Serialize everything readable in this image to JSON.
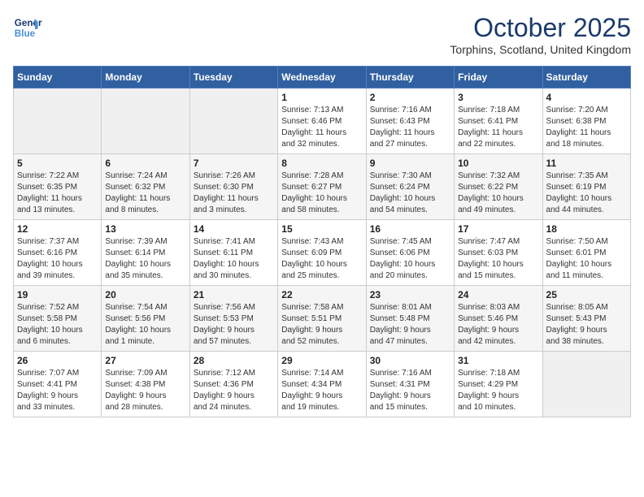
{
  "logo": {
    "line1": "General",
    "line2": "Blue"
  },
  "title": "October 2025",
  "subtitle": "Torphins, Scotland, United Kingdom",
  "headers": [
    "Sunday",
    "Monday",
    "Tuesday",
    "Wednesday",
    "Thursday",
    "Friday",
    "Saturday"
  ],
  "weeks": [
    [
      {
        "num": "",
        "info": ""
      },
      {
        "num": "",
        "info": ""
      },
      {
        "num": "",
        "info": ""
      },
      {
        "num": "1",
        "info": "Sunrise: 7:13 AM\nSunset: 6:46 PM\nDaylight: 11 hours\nand 32 minutes."
      },
      {
        "num": "2",
        "info": "Sunrise: 7:16 AM\nSunset: 6:43 PM\nDaylight: 11 hours\nand 27 minutes."
      },
      {
        "num": "3",
        "info": "Sunrise: 7:18 AM\nSunset: 6:41 PM\nDaylight: 11 hours\nand 22 minutes."
      },
      {
        "num": "4",
        "info": "Sunrise: 7:20 AM\nSunset: 6:38 PM\nDaylight: 11 hours\nand 18 minutes."
      }
    ],
    [
      {
        "num": "5",
        "info": "Sunrise: 7:22 AM\nSunset: 6:35 PM\nDaylight: 11 hours\nand 13 minutes."
      },
      {
        "num": "6",
        "info": "Sunrise: 7:24 AM\nSunset: 6:32 PM\nDaylight: 11 hours\nand 8 minutes."
      },
      {
        "num": "7",
        "info": "Sunrise: 7:26 AM\nSunset: 6:30 PM\nDaylight: 11 hours\nand 3 minutes."
      },
      {
        "num": "8",
        "info": "Sunrise: 7:28 AM\nSunset: 6:27 PM\nDaylight: 10 hours\nand 58 minutes."
      },
      {
        "num": "9",
        "info": "Sunrise: 7:30 AM\nSunset: 6:24 PM\nDaylight: 10 hours\nand 54 minutes."
      },
      {
        "num": "10",
        "info": "Sunrise: 7:32 AM\nSunset: 6:22 PM\nDaylight: 10 hours\nand 49 minutes."
      },
      {
        "num": "11",
        "info": "Sunrise: 7:35 AM\nSunset: 6:19 PM\nDaylight: 10 hours\nand 44 minutes."
      }
    ],
    [
      {
        "num": "12",
        "info": "Sunrise: 7:37 AM\nSunset: 6:16 PM\nDaylight: 10 hours\nand 39 minutes."
      },
      {
        "num": "13",
        "info": "Sunrise: 7:39 AM\nSunset: 6:14 PM\nDaylight: 10 hours\nand 35 minutes."
      },
      {
        "num": "14",
        "info": "Sunrise: 7:41 AM\nSunset: 6:11 PM\nDaylight: 10 hours\nand 30 minutes."
      },
      {
        "num": "15",
        "info": "Sunrise: 7:43 AM\nSunset: 6:09 PM\nDaylight: 10 hours\nand 25 minutes."
      },
      {
        "num": "16",
        "info": "Sunrise: 7:45 AM\nSunset: 6:06 PM\nDaylight: 10 hours\nand 20 minutes."
      },
      {
        "num": "17",
        "info": "Sunrise: 7:47 AM\nSunset: 6:03 PM\nDaylight: 10 hours\nand 15 minutes."
      },
      {
        "num": "18",
        "info": "Sunrise: 7:50 AM\nSunset: 6:01 PM\nDaylight: 10 hours\nand 11 minutes."
      }
    ],
    [
      {
        "num": "19",
        "info": "Sunrise: 7:52 AM\nSunset: 5:58 PM\nDaylight: 10 hours\nand 6 minutes."
      },
      {
        "num": "20",
        "info": "Sunrise: 7:54 AM\nSunset: 5:56 PM\nDaylight: 10 hours\nand 1 minute."
      },
      {
        "num": "21",
        "info": "Sunrise: 7:56 AM\nSunset: 5:53 PM\nDaylight: 9 hours\nand 57 minutes."
      },
      {
        "num": "22",
        "info": "Sunrise: 7:58 AM\nSunset: 5:51 PM\nDaylight: 9 hours\nand 52 minutes."
      },
      {
        "num": "23",
        "info": "Sunrise: 8:01 AM\nSunset: 5:48 PM\nDaylight: 9 hours\nand 47 minutes."
      },
      {
        "num": "24",
        "info": "Sunrise: 8:03 AM\nSunset: 5:46 PM\nDaylight: 9 hours\nand 42 minutes."
      },
      {
        "num": "25",
        "info": "Sunrise: 8:05 AM\nSunset: 5:43 PM\nDaylight: 9 hours\nand 38 minutes."
      }
    ],
    [
      {
        "num": "26",
        "info": "Sunrise: 7:07 AM\nSunset: 4:41 PM\nDaylight: 9 hours\nand 33 minutes."
      },
      {
        "num": "27",
        "info": "Sunrise: 7:09 AM\nSunset: 4:38 PM\nDaylight: 9 hours\nand 28 minutes."
      },
      {
        "num": "28",
        "info": "Sunrise: 7:12 AM\nSunset: 4:36 PM\nDaylight: 9 hours\nand 24 minutes."
      },
      {
        "num": "29",
        "info": "Sunrise: 7:14 AM\nSunset: 4:34 PM\nDaylight: 9 hours\nand 19 minutes."
      },
      {
        "num": "30",
        "info": "Sunrise: 7:16 AM\nSunset: 4:31 PM\nDaylight: 9 hours\nand 15 minutes."
      },
      {
        "num": "31",
        "info": "Sunrise: 7:18 AM\nSunset: 4:29 PM\nDaylight: 9 hours\nand 10 minutes."
      },
      {
        "num": "",
        "info": ""
      }
    ]
  ]
}
